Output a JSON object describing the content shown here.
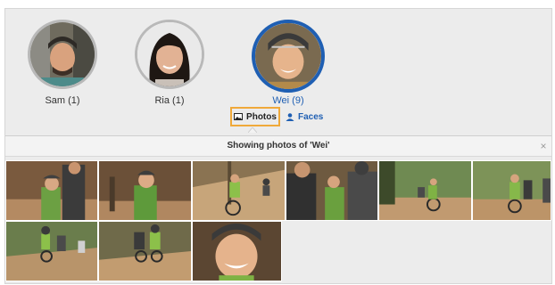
{
  "faces": [
    {
      "name": "Sam (1)",
      "selected": false
    },
    {
      "name": "Ria (1)",
      "selected": false
    },
    {
      "name": "Wei (9)",
      "selected": true
    }
  ],
  "view_toggle": {
    "photos_label": "Photos",
    "faces_label": "Faces"
  },
  "strip": {
    "title": "Showing photos of 'Wei'",
    "close_label": "×"
  },
  "photos": [
    {
      "label": "photo-1"
    },
    {
      "label": "photo-2"
    },
    {
      "label": "photo-3"
    },
    {
      "label": "photo-4"
    },
    {
      "label": "photo-5"
    },
    {
      "label": "photo-6"
    },
    {
      "label": "photo-7"
    },
    {
      "label": "photo-8"
    },
    {
      "label": "photo-9"
    },
    {
      "label": "photo-10"
    }
  ],
  "colors": {
    "accent": "#1f5fb3",
    "highlight": "#f0a93a"
  }
}
